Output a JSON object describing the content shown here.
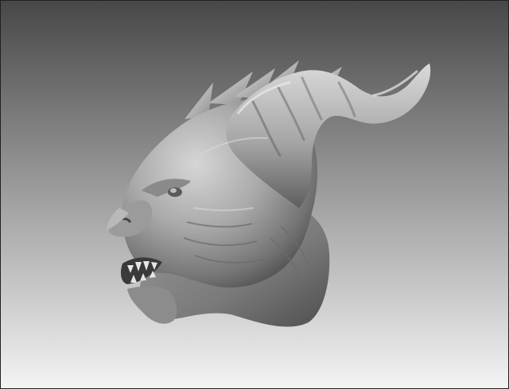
{
  "viewport": {
    "background_top": "#474747",
    "background_bottom": "#f4f4f4",
    "border": "#202020"
  },
  "model": {
    "subject": "sculpted-creature-head",
    "material_light": "#c8c8c8",
    "material_mid": "#8f8f8f",
    "material_dark": "#3e3e3e"
  }
}
